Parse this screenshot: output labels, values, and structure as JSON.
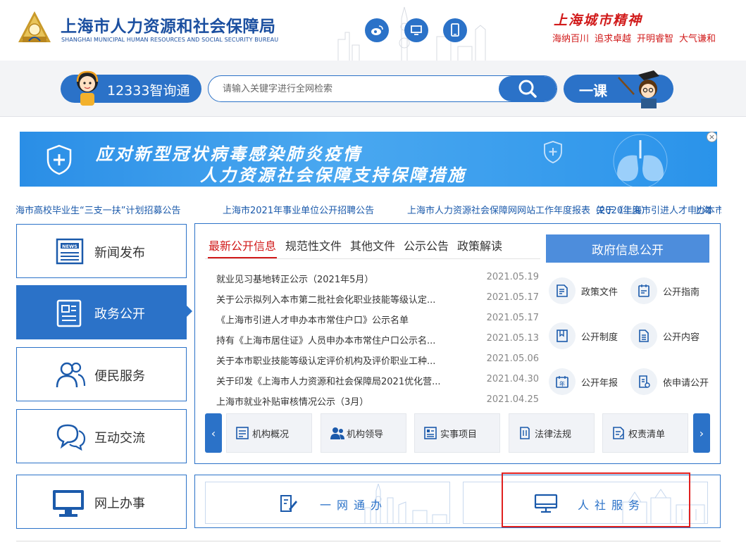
{
  "header": {
    "title_cn": "上海市人力资源和社会保障局",
    "title_en": "SHANGHAI MUNICIPAL HUMAN RESOURCES AND SOCIAL SECURITY BUREAU",
    "social_icons": [
      "weibo-icon",
      "desktop-icon",
      "mobile-icon"
    ],
    "spirit_title": "上海城市精神",
    "spirit_items": [
      "海纳百川",
      "追求卓越",
      "开明睿智",
      "大气谦和"
    ]
  },
  "search": {
    "assistant_label": "12333智询通",
    "placeholder": "请输入关键字进行全网检索",
    "course_label": "一课"
  },
  "banner": {
    "line1": "应对新型冠状病毒感染肺炎疫情",
    "line2": "人力资源社会保障支持保障措施",
    "close_symbol": "×"
  },
  "ticker": {
    "items": [
      "海市高校毕业生“三支一扶”计划招募公告",
      "上海市2021年事业单位公开招聘公告",
      "上海市人力资源社会保障网网站工作年度报表（2020年度）",
      "关于《上海市引进人才申办本市常住户口》",
      "上海"
    ]
  },
  "nav": {
    "items": [
      {
        "label": "新闻发布",
        "icon": "newspaper-icon"
      },
      {
        "label": "政务公开",
        "icon": "document-icon"
      },
      {
        "label": "便民服务",
        "icon": "users-icon"
      },
      {
        "label": "互动交流",
        "icon": "chat-icon"
      },
      {
        "label": "网上办事",
        "icon": "monitor-icon"
      }
    ]
  },
  "panel": {
    "tabs": [
      "最新公开信息",
      "规范性文件",
      "其他文件",
      "公示公告",
      "政策解读"
    ],
    "news": [
      {
        "title": "就业见习基地转正公示（2021年5月）",
        "date": "2021.05.19"
      },
      {
        "title": "关于公示拟列入本市第二批社会化职业技能等级认定...",
        "date": "2021.05.17"
      },
      {
        "title": "《上海市引进人才申办本市常住户口》公示名单",
        "date": "2021.05.17"
      },
      {
        "title": "持有《上海市居住证》人员申办本市常住户口公示名...",
        "date": "2021.05.13"
      },
      {
        "title": "关于本市职业技能等级认定评价机构及评价职业工种...",
        "date": "2021.05.06"
      },
      {
        "title": "关于印发《上海市人力资源和社会保障局2021优化营...",
        "date": "2021.04.30"
      },
      {
        "title": "上海市就业补贴审核情况公示（3月）",
        "date": "2021.04.25"
      }
    ],
    "gov_button": "政府信息公开",
    "gov_items": [
      {
        "label": "政策文件",
        "icon": "policy-file-icon"
      },
      {
        "label": "公开指南",
        "icon": "guide-icon"
      },
      {
        "label": "公开制度",
        "icon": "book-icon"
      },
      {
        "label": "公开内容",
        "icon": "content-icon"
      },
      {
        "label": "公开年报",
        "icon": "calendar-year-icon"
      },
      {
        "label": "依申请公开",
        "icon": "apply-icon"
      }
    ],
    "prev_symbol": "‹",
    "next_symbol": "›",
    "quick_links": [
      {
        "label": "机构概况",
        "icon": "org-icon"
      },
      {
        "label": "机构领导",
        "icon": "leader-icon"
      },
      {
        "label": "实事项目",
        "icon": "project-icon"
      },
      {
        "label": "法律法规",
        "icon": "law-icon"
      },
      {
        "label": "权责清单",
        "icon": "list-icon"
      }
    ]
  },
  "services": {
    "items": [
      {
        "label": "一网通办",
        "icon": "edit-icon"
      },
      {
        "label": "人社服务",
        "icon": "monitor-icon"
      }
    ]
  },
  "colors": {
    "primary": "#2b72c8",
    "accent_red": "#d11a1a",
    "banner_blue": "#3a9eee"
  }
}
